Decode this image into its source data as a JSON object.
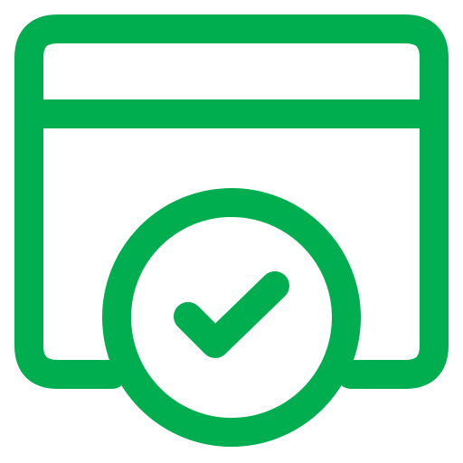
{
  "icon": {
    "name": "browser-window-check-icon",
    "color": "#00AE4F",
    "background": "#FFFFFF"
  }
}
